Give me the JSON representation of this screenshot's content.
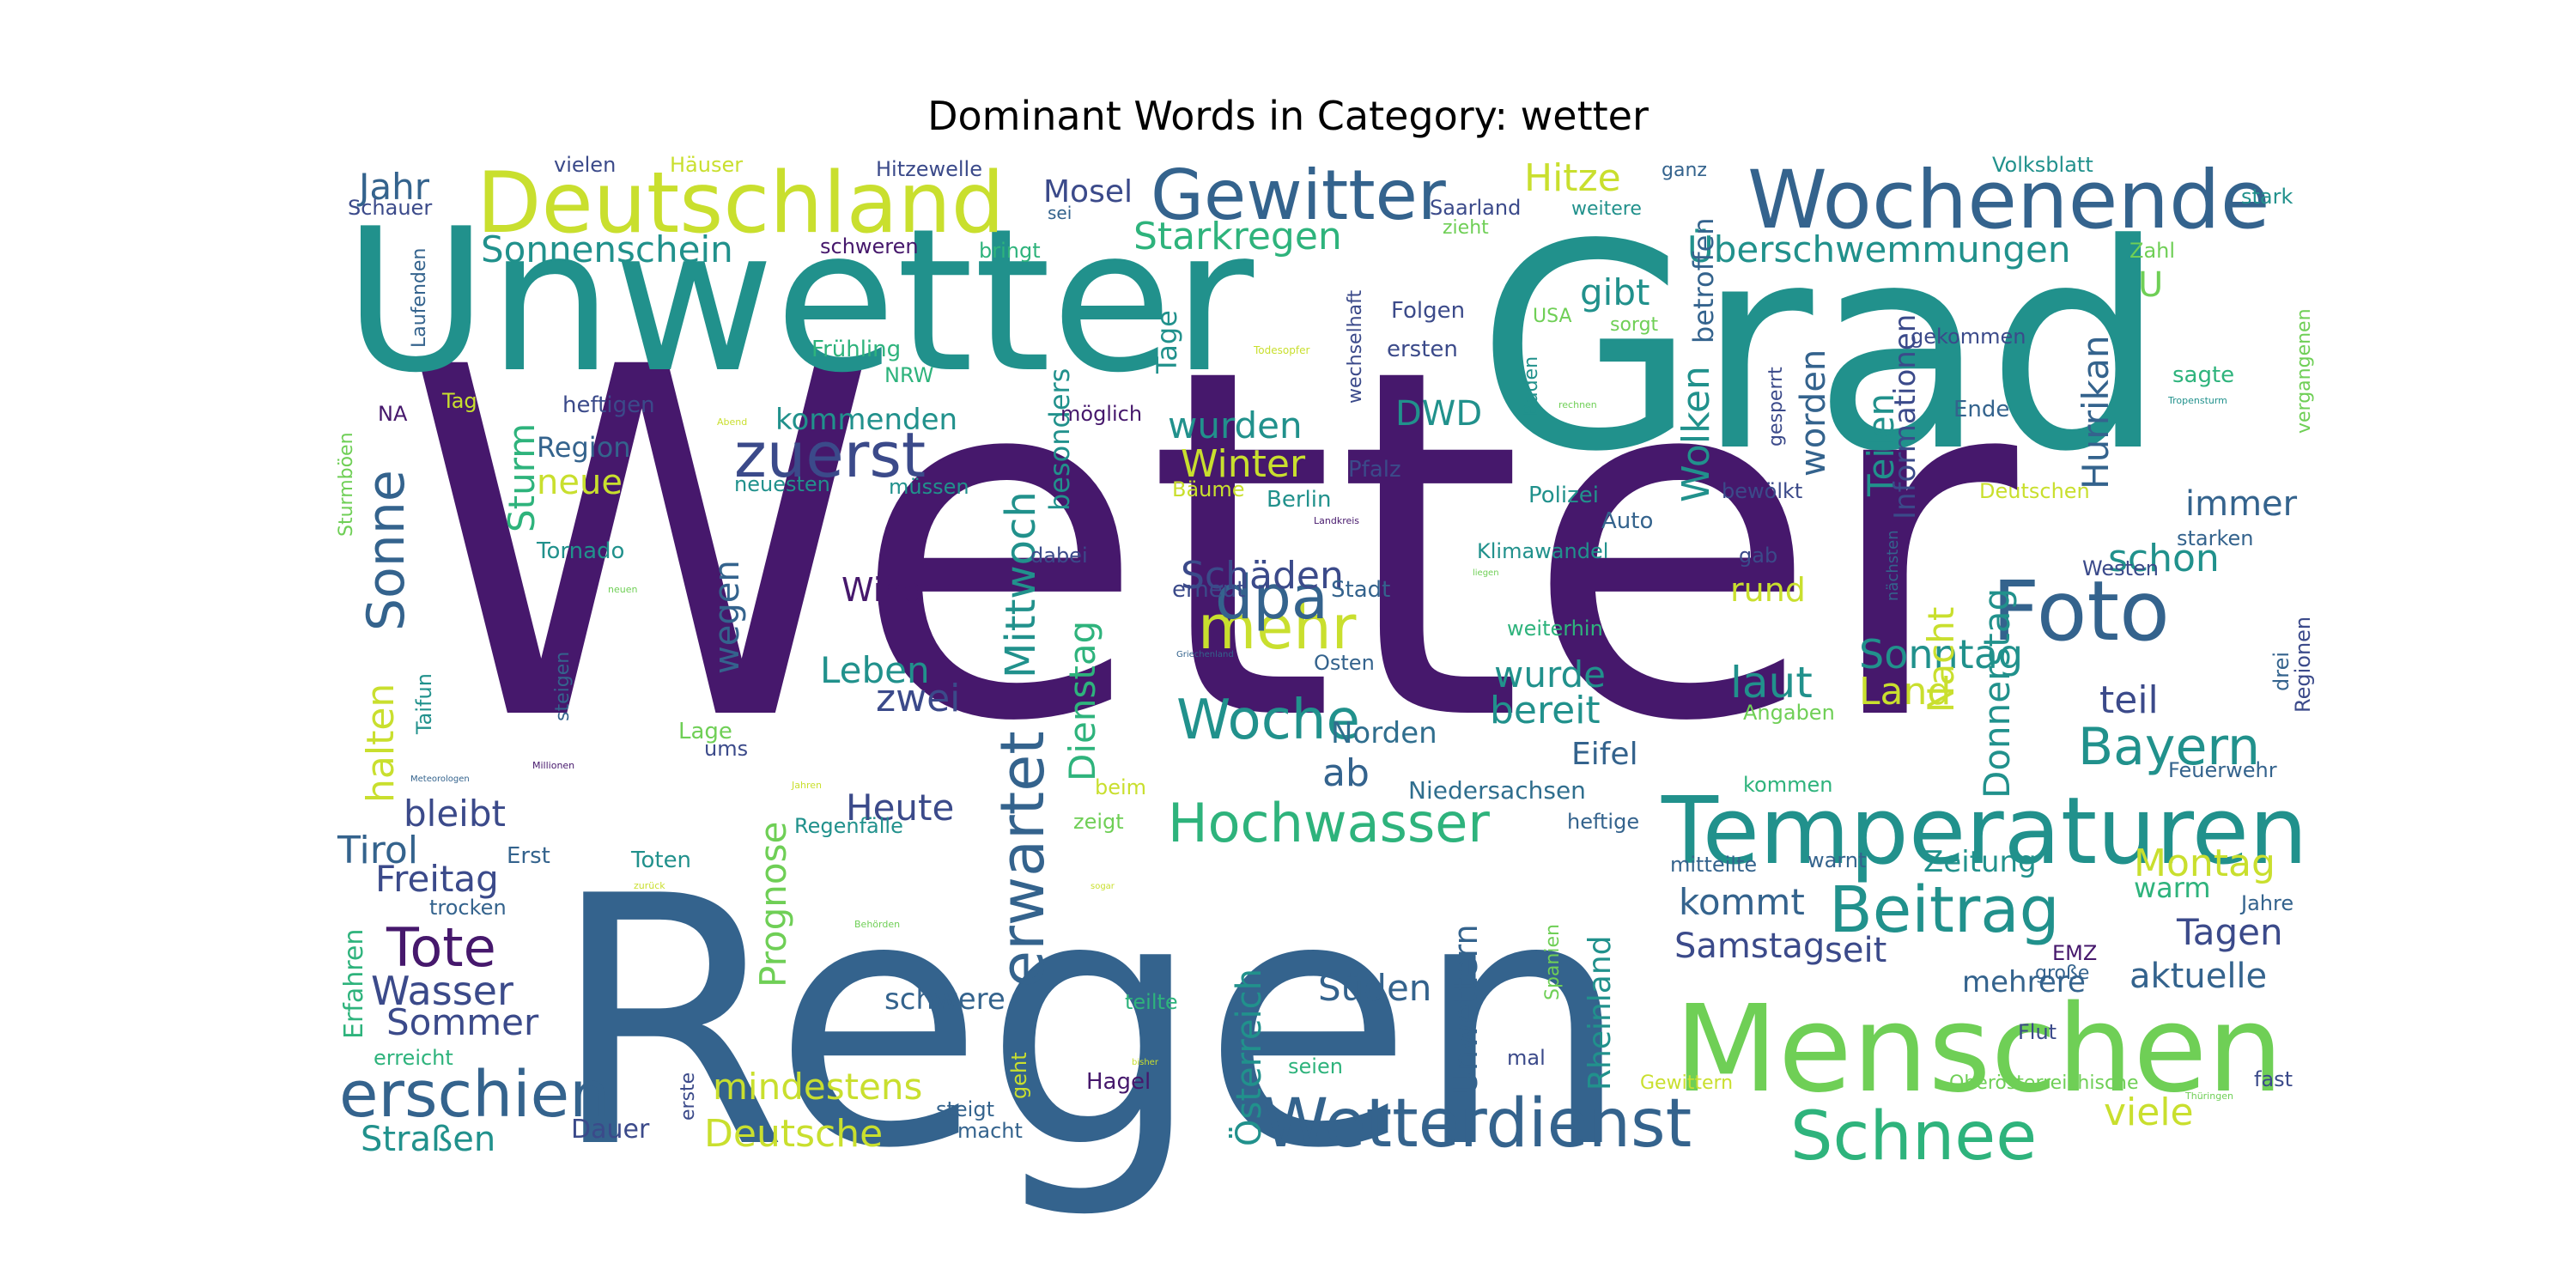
{
  "chart_data": {
    "type": "wordcloud",
    "title": "Dominant Words in Category: wetter",
    "colormap": "viridis",
    "palette": {
      "P": "#46186c",
      "B": "#34638d",
      "T": "#21918c",
      "G": "#2eb37c",
      "L": "#6fcf56",
      "Y": "#c9df2e",
      "D": "#3b4a8a",
      "I": "#2f6e8e"
    },
    "words": [
      {
        "text": "Wetter",
        "weight": 1.0,
        "color": "P"
      },
      {
        "text": "Regen",
        "weight": 0.78,
        "color": "B"
      },
      {
        "text": "Grad",
        "weight": 0.7,
        "color": "T"
      },
      {
        "text": "Unwetter",
        "weight": 0.6,
        "color": "T"
      },
      {
        "text": "Menschen",
        "weight": 0.4,
        "color": "L"
      },
      {
        "text": "Temperaturen",
        "weight": 0.36,
        "color": "T"
      },
      {
        "text": "Deutschland",
        "weight": 0.33,
        "color": "Y"
      },
      {
        "text": "Wochenende",
        "weight": 0.32,
        "color": "B"
      },
      {
        "text": "Foto",
        "weight": 0.3,
        "color": "B"
      },
      {
        "text": "Gewitter",
        "weight": 0.27,
        "color": "B"
      },
      {
        "text": "Wetterdienst",
        "weight": 0.25,
        "color": "B"
      },
      {
        "text": "Schnee",
        "weight": 0.25,
        "color": "G"
      },
      {
        "text": "erschien",
        "weight": 0.25,
        "color": "B"
      },
      {
        "text": "Beitrag",
        "weight": 0.23,
        "color": "T"
      },
      {
        "text": "zuerst",
        "weight": 0.23,
        "color": "D"
      },
      {
        "text": "erwartet",
        "weight": 0.23,
        "color": "B"
      },
      {
        "text": "Hochwasser",
        "weight": 0.21,
        "color": "G"
      },
      {
        "text": "Woche",
        "weight": 0.21,
        "color": "T"
      },
      {
        "text": "mehr",
        "weight": 0.21,
        "color": "Y"
      },
      {
        "text": "dpa",
        "weight": 0.21,
        "color": "B"
      },
      {
        "text": "Sonne",
        "weight": 0.19,
        "color": "B"
      },
      {
        "text": "Tote",
        "weight": 0.2,
        "color": "P"
      },
      {
        "text": "Bayern",
        "weight": 0.18,
        "color": "T"
      },
      {
        "text": "Jahr",
        "weight": 0.15,
        "color": "B"
      },
      {
        "text": "Hitze",
        "weight": 0.15,
        "color": "Y"
      },
      {
        "text": "Sonnenschein",
        "weight": 0.14,
        "color": "T"
      },
      {
        "text": "Starkregen",
        "weight": 0.14,
        "color": "G"
      },
      {
        "text": "Überschwemmungen",
        "weight": 0.14,
        "color": "T"
      },
      {
        "text": "Mosel",
        "weight": 0.11,
        "color": "D"
      },
      {
        "text": "Mittwoch",
        "weight": 0.16,
        "color": "T"
      },
      {
        "text": "Dienstag",
        "weight": 0.14,
        "color": "G"
      },
      {
        "text": "Prognose",
        "weight": 0.13,
        "color": "L"
      },
      {
        "text": "Österreich",
        "weight": 0.13,
        "color": "T"
      },
      {
        "text": "Unwettern",
        "weight": 0.13,
        "color": "B"
      },
      {
        "text": "Rheinland",
        "weight": 0.12,
        "color": "T"
      },
      {
        "text": "Deutsche",
        "weight": 0.14,
        "color": "Y"
      },
      {
        "text": "mindestens",
        "weight": 0.13,
        "color": "Y"
      },
      {
        "text": "Straßen",
        "weight": 0.12,
        "color": "T"
      },
      {
        "text": "Wasser",
        "weight": 0.13,
        "color": "D"
      },
      {
        "text": "Sommer",
        "weight": 0.12,
        "color": "D"
      },
      {
        "text": "Freitag",
        "weight": 0.13,
        "color": "D"
      },
      {
        "text": "Tirol",
        "weight": 0.13,
        "color": "B"
      },
      {
        "text": "bleibt",
        "weight": 0.12,
        "color": "D"
      },
      {
        "text": "halten",
        "weight": 0.13,
        "color": "Y"
      },
      {
        "text": "Heute",
        "weight": 0.13,
        "color": "D"
      },
      {
        "text": "ab",
        "weight": 0.12,
        "color": "B"
      },
      {
        "text": "Leben",
        "weight": 0.12,
        "color": "T"
      },
      {
        "text": "zwei",
        "weight": 0.12,
        "color": "D"
      },
      {
        "text": "Schäden",
        "weight": 0.13,
        "color": "D"
      },
      {
        "text": "wurde",
        "weight": 0.11,
        "color": "T"
      },
      {
        "text": "bereit",
        "weight": 0.12,
        "color": "T"
      },
      {
        "text": "laut",
        "weight": 0.12,
        "color": "T"
      },
      {
        "text": "Sonntag",
        "weight": 0.13,
        "color": "T"
      },
      {
        "text": "teil",
        "weight": 0.12,
        "color": "D"
      },
      {
        "text": "schon",
        "weight": 0.13,
        "color": "T"
      },
      {
        "text": "immer",
        "weight": 0.12,
        "color": "B"
      },
      {
        "text": "Land",
        "weight": 0.12,
        "color": "Y"
      },
      {
        "text": "Donnerstag",
        "weight": 0.13,
        "color": "T"
      },
      {
        "text": "Nacht",
        "weight": 0.13,
        "color": "Y"
      },
      {
        "text": "Hurrikan",
        "weight": 0.12,
        "color": "B"
      },
      {
        "text": "Teilen",
        "weight": 0.12,
        "color": "T"
      },
      {
        "text": "worden",
        "weight": 0.12,
        "color": "B"
      },
      {
        "text": "Wolken",
        "weight": 0.12,
        "color": "T"
      },
      {
        "text": "gibt",
        "weight": 0.12,
        "color": "T"
      },
      {
        "text": "wurden",
        "weight": 0.12,
        "color": "T"
      },
      {
        "text": "Winter",
        "weight": 0.12,
        "color": "Y"
      },
      {
        "text": "DWD",
        "weight": 0.12,
        "color": "T"
      },
      {
        "text": "kommenden",
        "weight": 0.1,
        "color": "T"
      },
      {
        "text": "Region",
        "weight": 0.09,
        "color": "B"
      },
      {
        "text": "neue",
        "weight": 0.12,
        "color": "Y"
      },
      {
        "text": "Sturm",
        "weight": 0.12,
        "color": "G"
      },
      {
        "text": "wegen",
        "weight": 0.11,
        "color": "B"
      },
      {
        "text": "Wind",
        "weight": 0.1,
        "color": "P"
      },
      {
        "text": "Samstag",
        "weight": 0.11,
        "color": "D"
      },
      {
        "text": "seit",
        "weight": 0.11,
        "color": "D"
      },
      {
        "text": "kommt",
        "weight": 0.11,
        "color": "B"
      },
      {
        "text": "Süden",
        "weight": 0.12,
        "color": "B"
      },
      {
        "text": "schwere",
        "weight": 0.1,
        "color": "B"
      },
      {
        "text": "Zeitung",
        "weight": 0.1,
        "color": "T"
      },
      {
        "text": "Montag",
        "weight": 0.12,
        "color": "Y"
      },
      {
        "text": "warm",
        "weight": 0.1,
        "color": "G"
      },
      {
        "text": "Tagen",
        "weight": 0.11,
        "color": "D"
      },
      {
        "text": "aktuelle",
        "weight": 0.11,
        "color": "B"
      },
      {
        "text": "mehrere",
        "weight": 0.1,
        "color": "B"
      },
      {
        "text": "viele",
        "weight": 0.12,
        "color": "Y"
      },
      {
        "text": "Eifel",
        "weight": 0.1,
        "color": "B"
      },
      {
        "text": "Norden",
        "weight": 0.1,
        "color": "I"
      },
      {
        "text": "Niedersachsen",
        "weight": 0.08,
        "color": "I"
      },
      {
        "text": "Tage",
        "weight": 0.09,
        "color": "T"
      },
      {
        "text": "besonders",
        "weight": 0.09,
        "color": "T"
      },
      {
        "text": "Informationen",
        "weight": 0.09,
        "color": "D"
      },
      {
        "text": "betroffen",
        "weight": 0.09,
        "color": "B"
      },
      {
        "text": "Folgen",
        "weight": 0.07,
        "color": "D"
      },
      {
        "text": "ersten",
        "weight": 0.07,
        "color": "D"
      },
      {
        "text": "Frühling",
        "weight": 0.07,
        "color": "G"
      },
      {
        "text": "NRW",
        "weight": 0.07,
        "color": "G"
      },
      {
        "text": "heftigen",
        "weight": 0.07,
        "color": "D"
      },
      {
        "text": "Tornado",
        "weight": 0.07,
        "color": "T"
      },
      {
        "text": "neuesten",
        "weight": 0.07,
        "color": "T"
      },
      {
        "text": "müssen",
        "weight": 0.07,
        "color": "T"
      },
      {
        "text": "möglich",
        "weight": 0.07,
        "color": "P"
      },
      {
        "text": "Bäume",
        "weight": 0.07,
        "color": "Y"
      },
      {
        "text": "Berlin",
        "weight": 0.07,
        "color": "T"
      },
      {
        "text": "Pfalz",
        "weight": 0.07,
        "color": "D"
      },
      {
        "text": "Polizei",
        "weight": 0.07,
        "color": "T"
      },
      {
        "text": "Auto",
        "weight": 0.07,
        "color": "B"
      },
      {
        "text": "Klimawandel",
        "weight": 0.07,
        "color": "T"
      },
      {
        "text": "dabei",
        "weight": 0.07,
        "color": "D"
      },
      {
        "text": "erneut",
        "weight": 0.07,
        "color": "D"
      },
      {
        "text": "Stadt",
        "weight": 0.07,
        "color": "B"
      },
      {
        "text": "Osten",
        "weight": 0.07,
        "color": "B"
      },
      {
        "text": "weiterhin",
        "weight": 0.07,
        "color": "G"
      },
      {
        "text": "rund",
        "weight": 0.1,
        "color": "Y"
      },
      {
        "text": "gab",
        "weight": 0.07,
        "color": "D"
      },
      {
        "text": "Westen",
        "weight": 0.07,
        "color": "D"
      },
      {
        "text": "starken",
        "weight": 0.07,
        "color": "B"
      },
      {
        "text": "Regionen",
        "weight": 0.06,
        "color": "D"
      },
      {
        "text": "drei",
        "weight": 0.06,
        "color": "B"
      },
      {
        "text": "Angaben",
        "weight": 0.07,
        "color": "L"
      },
      {
        "text": "Feuerwehr",
        "weight": 0.07,
        "color": "B"
      },
      {
        "text": "kommen",
        "weight": 0.07,
        "color": "G"
      },
      {
        "text": "heftige",
        "weight": 0.07,
        "color": "B"
      },
      {
        "text": "zeigt",
        "weight": 0.07,
        "color": "L"
      },
      {
        "text": "beim",
        "weight": 0.07,
        "color": "Y"
      },
      {
        "text": "Regenfälle",
        "weight": 0.07,
        "color": "T"
      },
      {
        "text": "mitteilte",
        "weight": 0.07,
        "color": "B"
      },
      {
        "text": "warnt",
        "weight": 0.07,
        "color": "B"
      },
      {
        "text": "EMZ",
        "weight": 0.07,
        "color": "P"
      },
      {
        "text": "große",
        "weight": 0.06,
        "color": "B"
      },
      {
        "text": "Jahre",
        "weight": 0.07,
        "color": "B"
      },
      {
        "text": "Flut",
        "weight": 0.07,
        "color": "D"
      },
      {
        "text": "fast",
        "weight": 0.07,
        "color": "D"
      },
      {
        "text": "Oberösterreichische",
        "weight": 0.07,
        "color": "L"
      },
      {
        "text": "Gewittern",
        "weight": 0.07,
        "color": "Y"
      },
      {
        "text": "mal",
        "weight": 0.07,
        "color": "D"
      },
      {
        "text": "Spanien",
        "weight": 0.06,
        "color": "L"
      },
      {
        "text": "seien",
        "weight": 0.07,
        "color": "G"
      },
      {
        "text": "Hagel",
        "weight": 0.07,
        "color": "P"
      },
      {
        "text": "steigt",
        "weight": 0.07,
        "color": "B"
      },
      {
        "text": "macht",
        "weight": 0.07,
        "color": "B"
      },
      {
        "text": "geht",
        "weight": 0.07,
        "color": "Y"
      },
      {
        "text": "teilte",
        "weight": 0.07,
        "color": "G"
      },
      {
        "text": "erste",
        "weight": 0.07,
        "color": "D"
      },
      {
        "text": "Dauer",
        "weight": 0.07,
        "color": "D"
      },
      {
        "text": "erreicht",
        "weight": 0.07,
        "color": "G"
      },
      {
        "text": "Erfahren",
        "weight": 0.08,
        "color": "G"
      },
      {
        "text": "trocken",
        "weight": 0.07,
        "color": "B"
      },
      {
        "text": "Erst",
        "weight": 0.07,
        "color": "B"
      },
      {
        "text": "Toten",
        "weight": 0.07,
        "color": "T"
      },
      {
        "text": "ums",
        "weight": 0.07,
        "color": "D"
      },
      {
        "text": "Lage",
        "weight": 0.07,
        "color": "L"
      },
      {
        "text": "steigen",
        "weight": 0.06,
        "color": "B"
      },
      {
        "text": "Taifun",
        "weight": 0.07,
        "color": "T"
      },
      {
        "text": "Sturmböen",
        "weight": 0.06,
        "color": "L"
      },
      {
        "text": "NA",
        "weight": 0.07,
        "color": "P"
      },
      {
        "text": "Tag",
        "weight": 0.07,
        "color": "Y"
      },
      {
        "text": "Laufenden",
        "weight": 0.06,
        "color": "B"
      },
      {
        "text": "Schauer",
        "weight": 0.07,
        "color": "D"
      },
      {
        "text": "vielen",
        "weight": 0.07,
        "color": "D"
      },
      {
        "text": "Häuser",
        "weight": 0.07,
        "color": "Y"
      },
      {
        "text": "Hitzewelle",
        "weight": 0.07,
        "color": "D"
      },
      {
        "text": "sei",
        "weight": 0.06,
        "color": "B"
      },
      {
        "text": "schweren",
        "weight": 0.07,
        "color": "P"
      },
      {
        "text": "bringt",
        "weight": 0.07,
        "color": "G"
      },
      {
        "text": "ganz",
        "weight": 0.07,
        "color": "B"
      },
      {
        "text": "Saarland",
        "weight": 0.07,
        "color": "D"
      },
      {
        "text": "weitere",
        "weight": 0.07,
        "color": "T"
      },
      {
        "text": "zieht",
        "weight": 0.06,
        "color": "L"
      },
      {
        "text": "Volksblatt",
        "weight": 0.07,
        "color": "T"
      },
      {
        "text": "stark",
        "weight": 0.07,
        "color": "T"
      },
      {
        "text": "Zahl",
        "weight": 0.07,
        "color": "L"
      },
      {
        "text": "U",
        "weight": 0.1,
        "color": "L"
      },
      {
        "text": "USA",
        "weight": 0.07,
        "color": "L"
      },
      {
        "text": "sorgt",
        "weight": 0.07,
        "color": "L"
      },
      {
        "text": "gekommen",
        "weight": 0.07,
        "color": "D"
      },
      {
        "text": "Ende",
        "weight": 0.07,
        "color": "B"
      },
      {
        "text": "gesperrt",
        "weight": 0.06,
        "color": "D"
      },
      {
        "text": "bewölkt",
        "weight": 0.07,
        "color": "D"
      },
      {
        "text": "Deutschen",
        "weight": 0.07,
        "color": "Y"
      },
      {
        "text": "sagte",
        "weight": 0.07,
        "color": "G"
      },
      {
        "text": "vergangenen",
        "weight": 0.06,
        "color": "L"
      },
      {
        "text": "Baden",
        "weight": 0.07,
        "color": "T"
      },
      {
        "text": "wechselhaft",
        "weight": 0.06,
        "color": "D"
      },
      {
        "text": "nächsten",
        "weight": 0.06,
        "color": "B"
      },
      {
        "text": "Todesopfer",
        "weight": 0.03,
        "color": "Y"
      },
      {
        "text": "Abend",
        "weight": 0.03,
        "color": "Y"
      },
      {
        "text": "rechnen",
        "weight": 0.03,
        "color": "L"
      },
      {
        "text": "Tropensturm",
        "weight": 0.03,
        "color": "T"
      },
      {
        "text": "Landkreis",
        "weight": 0.03,
        "color": "P"
      },
      {
        "text": "neuen",
        "weight": 0.03,
        "color": "L"
      },
      {
        "text": "Griechenland",
        "weight": 0.03,
        "color": "B"
      },
      {
        "text": "liegen",
        "weight": 0.03,
        "color": "L"
      },
      {
        "text": "Meteorologen",
        "weight": 0.03,
        "color": "B"
      },
      {
        "text": "Millionen",
        "weight": 0.03,
        "color": "P"
      },
      {
        "text": "Jahren",
        "weight": 0.03,
        "color": "Y"
      },
      {
        "text": "zurück",
        "weight": 0.03,
        "color": "Y"
      },
      {
        "text": "sogar",
        "weight": 0.03,
        "color": "Y"
      },
      {
        "text": "Behörden",
        "weight": 0.03,
        "color": "L"
      },
      {
        "text": "bisher",
        "weight": 0.03,
        "color": "Y"
      },
      {
        "text": "Thüringen",
        "weight": 0.03,
        "color": "L"
      }
    ]
  }
}
